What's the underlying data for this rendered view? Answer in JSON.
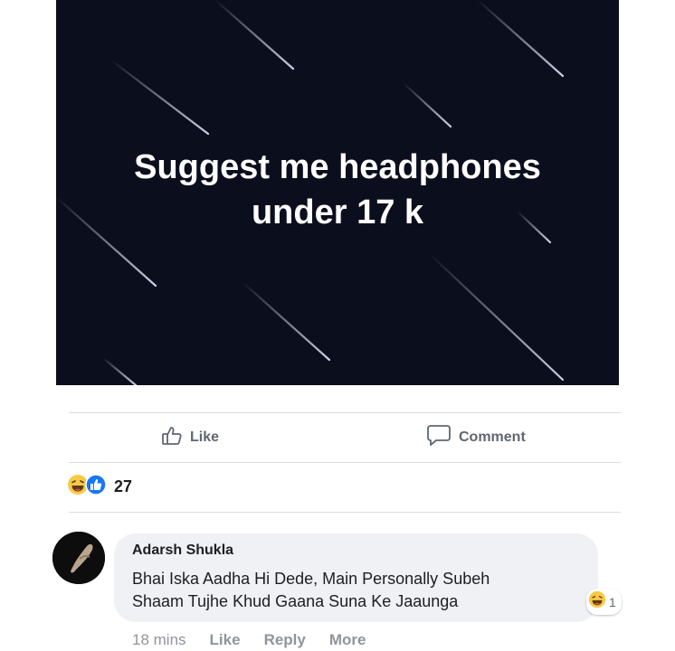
{
  "post": {
    "text_lines": [
      "Suggest me headphones",
      "under 17 k"
    ]
  },
  "actions": {
    "like_label": "Like",
    "comment_label": "Comment",
    "like_icon": "thumbs-up-icon",
    "comment_icon": "speech-bubble-icon"
  },
  "reactions": {
    "count": "27",
    "types": [
      "haha",
      "like"
    ]
  },
  "comment": {
    "author": "Adarsh Shukla",
    "text_lines": [
      "Bhai Iska Aadha Hi Dede, Main Personally Subeh",
      "Shaam Tujhe Khud Gaana Suna Ke Jaaunga"
    ],
    "reaction_count": "1",
    "reaction_type": "haha",
    "time": "18 mins",
    "like_label": "Like",
    "reply_label": "Reply",
    "more_label": "More"
  },
  "colors": {
    "post_background": "#0b0e1c",
    "bubble": "#eff1f4",
    "action_text": "#606770",
    "meta_text": "#90949c",
    "like_blue": "#1877f2",
    "haha_yellow": "#f7c948"
  }
}
